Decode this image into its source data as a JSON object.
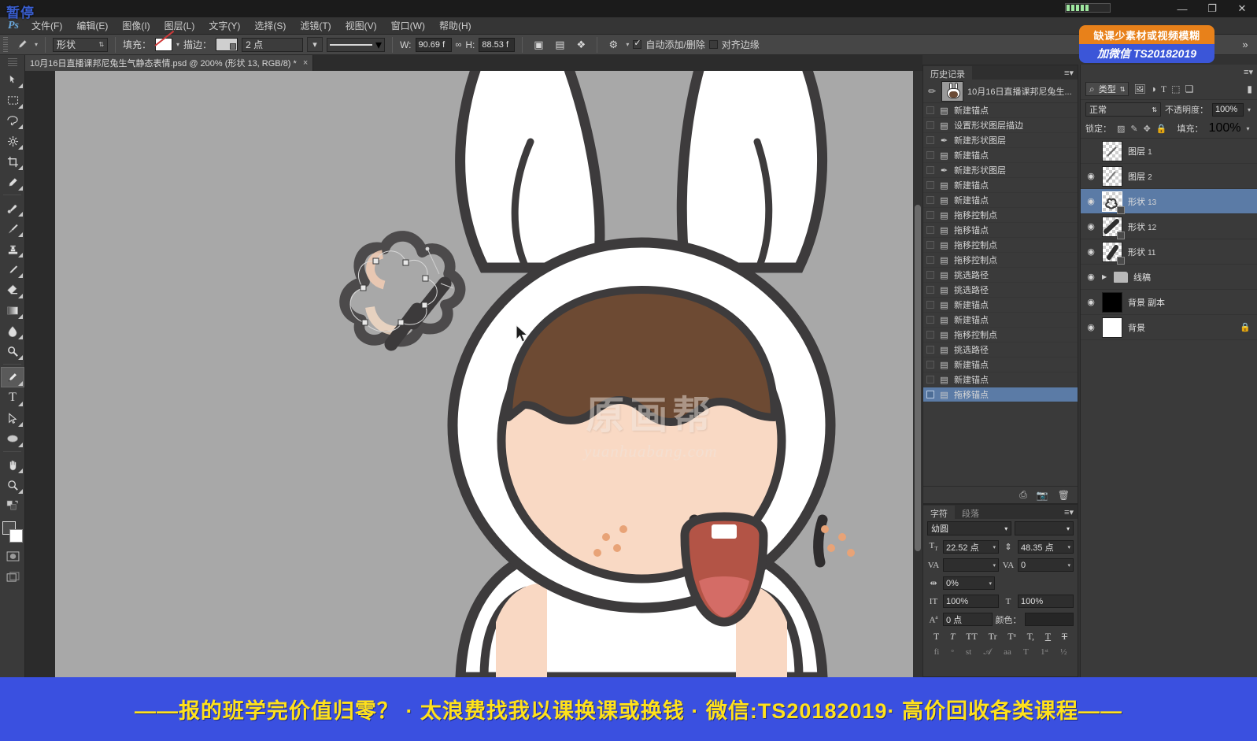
{
  "app": {
    "name": "Adobe Photoshop",
    "pause_overlay": "暂停",
    "logo": "Ps"
  },
  "titlebar": {
    "minimize": "—",
    "restore": "❐",
    "close": "✕"
  },
  "menu": {
    "items": [
      {
        "label": "文件(F)"
      },
      {
        "label": "编辑(E)"
      },
      {
        "label": "图像(I)"
      },
      {
        "label": "图层(L)"
      },
      {
        "label": "文字(Y)"
      },
      {
        "label": "选择(S)"
      },
      {
        "label": "滤镜(T)"
      },
      {
        "label": "视图(V)"
      },
      {
        "label": "窗口(W)"
      },
      {
        "label": "帮助(H)"
      }
    ]
  },
  "options_bar": {
    "tool_icon": "pen-tool-icon",
    "mode_value": "形状",
    "fill_label": "填充：",
    "stroke_label": "描边：",
    "stroke_width": "2 点",
    "width_label": "W:",
    "width_value": "90.69 f",
    "link_icon": "link-icon",
    "height_label": "H:",
    "height_value": "88.53 f",
    "path_ops_icon": "path-operations-icon",
    "align_icon": "path-align-icon",
    "arrange_icon": "path-arrange-icon",
    "gear_icon": "gear-icon",
    "auto_add_delete": "自动添加/删除",
    "align_edges": "对齐边缘"
  },
  "document_tab": {
    "title": "10月16日直播课邦尼兔生气静态表情.psd @ 200% (形状 13, RGB/8) *",
    "close": "×"
  },
  "toolbox": {
    "tools": [
      {
        "name": "move-tool",
        "glyph": "✥"
      },
      {
        "name": "marquee-tool",
        "glyph": "▭"
      },
      {
        "name": "lasso-tool",
        "glyph": "◣"
      },
      {
        "name": "quick-select-tool",
        "glyph": "✦"
      },
      {
        "name": "crop-tool",
        "glyph": "⌗"
      },
      {
        "name": "eyedropper-tool",
        "glyph": "✎"
      },
      {
        "name": "healing-brush-tool",
        "glyph": "✚"
      },
      {
        "name": "brush-tool",
        "glyph": "🖌"
      },
      {
        "name": "clone-stamp-tool",
        "glyph": "♜"
      },
      {
        "name": "history-brush-tool",
        "glyph": "✒"
      },
      {
        "name": "eraser-tool",
        "glyph": "▰"
      },
      {
        "name": "gradient-tool",
        "glyph": "▤"
      },
      {
        "name": "blur-tool",
        "glyph": "◭"
      },
      {
        "name": "dodge-tool",
        "glyph": "◐"
      },
      {
        "name": "pen-tool",
        "glyph": "✑",
        "selected": true
      },
      {
        "name": "type-tool",
        "glyph": "T"
      },
      {
        "name": "path-selection-tool",
        "glyph": "➤"
      },
      {
        "name": "shape-tool",
        "glyph": "⬭"
      },
      {
        "name": "hand-tool",
        "glyph": "✋"
      },
      {
        "name": "zoom-tool",
        "glyph": "🔍"
      },
      {
        "name": "quick-mask-mode",
        "glyph": "◎"
      },
      {
        "name": "screen-mode",
        "glyph": "❐"
      }
    ]
  },
  "history_panel": {
    "tab_label": "历史记录",
    "snapshot_name": "10月16日直播课邦尼兔生...",
    "items": [
      {
        "label": "新建锚点",
        "icon": "document-icon"
      },
      {
        "label": "设置形状图层描边",
        "icon": "document-icon"
      },
      {
        "label": "新建形状图层",
        "icon": "pen-icon"
      },
      {
        "label": "新建锚点",
        "icon": "document-icon"
      },
      {
        "label": "新建形状图层",
        "icon": "pen-icon"
      },
      {
        "label": "新建锚点",
        "icon": "document-icon"
      },
      {
        "label": "新建锚点",
        "icon": "document-icon"
      },
      {
        "label": "拖移控制点",
        "icon": "document-icon"
      },
      {
        "label": "拖移锚点",
        "icon": "document-icon"
      },
      {
        "label": "拖移控制点",
        "icon": "document-icon"
      },
      {
        "label": "拖移控制点",
        "icon": "document-icon"
      },
      {
        "label": "挑选路径",
        "icon": "document-icon"
      },
      {
        "label": "挑选路径",
        "icon": "document-icon"
      },
      {
        "label": "新建锚点",
        "icon": "document-icon"
      },
      {
        "label": "新建锚点",
        "icon": "document-icon"
      },
      {
        "label": "拖移控制点",
        "icon": "document-icon"
      },
      {
        "label": "挑选路径",
        "icon": "document-icon"
      },
      {
        "label": "新建锚点",
        "icon": "document-icon"
      },
      {
        "label": "新建锚点",
        "icon": "document-icon"
      },
      {
        "label": "拖移锚点",
        "icon": "document-icon",
        "selected": true
      }
    ],
    "footer": {
      "new_snapshot_icon": "new-snapshot-icon",
      "camera_icon": "camera-icon",
      "trash_icon": "trash-icon"
    }
  },
  "character_panel": {
    "tabs": [
      {
        "label": "字符",
        "active": true
      },
      {
        "label": "段落",
        "active": false
      }
    ],
    "font_family": "幼圆",
    "font_style": "",
    "font_size_label": "size-icon",
    "font_size": "22.52 点",
    "leading_label": "leading-icon",
    "leading": "48.35 点",
    "kerning_label": "VA",
    "kerning": "",
    "tracking_label": "VA",
    "tracking": "0",
    "vscale_label": "vertical-scale-icon",
    "vscale": "0%",
    "hscale_label": "horizontal-scale-icon",
    "hscale": "100%",
    "vscale2": "100%",
    "baseline_label": "baseline-shift-icon",
    "baseline": "0 点",
    "color_label": "颜色：",
    "color_value": "#262626",
    "style_glyphs": [
      "T",
      "T",
      "TT",
      "Tr",
      "Tᵃ",
      "T,",
      "T",
      "Ŧ"
    ],
    "opentype_glyphs": [
      "fi",
      "ᵒ",
      "st",
      "𝒜",
      "aa",
      "T",
      "1ˢᵗ",
      "½"
    ]
  },
  "layers_panel": {
    "filter": {
      "search_icon": "search-icon",
      "kind_label": "类型",
      "icons": [
        "pixel-filter-icon",
        "adjustment-filter-icon",
        "type-filter-icon",
        "shape-filter-icon",
        "smartobject-filter-icon"
      ],
      "toggle_icon": "filter-toggle-icon"
    },
    "blend_mode": "正常",
    "opacity_label": "不透明度：",
    "opacity_value": "100%",
    "lock_label": "锁定：",
    "lock_icons": [
      "lock-transparent-icon",
      "lock-image-icon",
      "lock-position-icon",
      "lock-all-icon"
    ],
    "fill_label": "填充：",
    "fill_value": "100%",
    "layers": [
      {
        "name": "图层",
        "num": "1",
        "visible": false,
        "type": "pixel",
        "selected": false
      },
      {
        "name": "图层",
        "num": "2",
        "visible": true,
        "type": "pixel",
        "selected": false
      },
      {
        "name": "形状",
        "num": "13",
        "visible": true,
        "type": "shape",
        "selected": true
      },
      {
        "name": "形状",
        "num": "12",
        "visible": true,
        "type": "shape",
        "selected": false
      },
      {
        "name": "形状",
        "num": "11",
        "visible": true,
        "type": "shape",
        "selected": false
      },
      {
        "name": "线稿",
        "num": "",
        "visible": true,
        "type": "group",
        "selected": false
      },
      {
        "name": "背景 副本",
        "num": "",
        "visible": true,
        "type": "black",
        "selected": false
      },
      {
        "name": "背景",
        "num": "",
        "visible": true,
        "type": "white",
        "selected": false,
        "locked": true
      }
    ]
  },
  "canvas": {
    "watermark_cn": "原画帮",
    "watermark_en": "yuanhuabang.com",
    "zoom": "200%",
    "background_color": "#a8a8a8"
  },
  "ads": {
    "top_line1": "缺课少素材或视频模糊",
    "top_line2": "加微信 TS20182019",
    "top_color1": "#e8811a",
    "top_color2": "#3b56d8",
    "bottom_text": "——报的班学完价值归零？ · 太浪费找我以课换课或换钱 · 微信:TS20182019· 高价回收各类课程——",
    "bottom_bg": "#3a50e0",
    "bottom_fg": "#ffe11b"
  }
}
